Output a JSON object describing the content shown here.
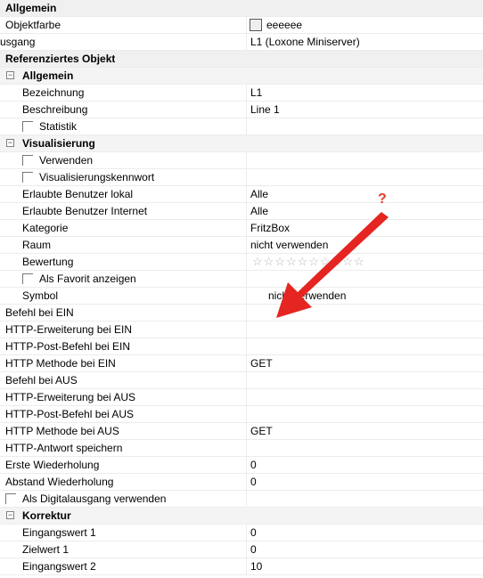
{
  "colors": {
    "accent_arrow": "#e52521",
    "question_mark": "#e23a2e",
    "category_bg": "#f0f0f0"
  },
  "icons": {
    "collapse": "minus-box-icon",
    "checkbox": "checkbox-icon",
    "rating": "star-icon"
  },
  "properties": {
    "cat_allgemein": "Allgemein",
    "objektfarbe": {
      "label": "Objektfarbe",
      "value": "eeeeee",
      "swatch_color": "#eeeeee"
    },
    "ausgang": {
      "label": "usgang",
      "value": "L1 (Loxone Miniserver)"
    },
    "cat_ref": "Referenziertes Objekt",
    "sub_allgemein": "Allgemein",
    "bezeichnung": {
      "label": "Bezeichnung",
      "value": "L1"
    },
    "beschreibung": {
      "label": "Beschreibung",
      "value": "Line 1"
    },
    "statistik": {
      "label": "Statistik",
      "checked": false
    },
    "sub_visualisierung": "Visualisierung",
    "verwenden": {
      "label": "Verwenden",
      "checked": false
    },
    "vis_kennwort": {
      "label": "Visualisierungskennwort",
      "checked": false
    },
    "benutzer_lokal": {
      "label": "Erlaubte Benutzer lokal",
      "value": "Alle"
    },
    "benutzer_internet": {
      "label": "Erlaubte Benutzer Internet",
      "value": "Alle"
    },
    "kategorie": {
      "label": "Kategorie",
      "value": "FritzBox"
    },
    "raum": {
      "label": "Raum",
      "value": "nicht verwenden"
    },
    "bewertung": {
      "label": "Bewertung",
      "stars": "☆☆☆☆☆☆☆☆☆☆",
      "rating": 0,
      "max": 10
    },
    "favorit": {
      "label": "Als Favorit anzeigen",
      "checked": false
    },
    "symbol": {
      "label": "Symbol",
      "value": "nicht verwenden"
    },
    "befehl_ein": {
      "label": "Befehl bei EIN",
      "value": ""
    },
    "http_erw_ein": {
      "label": "HTTP-Erweiterung bei EIN",
      "value": ""
    },
    "http_post_ein": {
      "label": "HTTP-Post-Befehl bei EIN",
      "value": ""
    },
    "http_methode_ein": {
      "label": "HTTP Methode bei EIN",
      "value": "GET"
    },
    "befehl_aus": {
      "label": "Befehl bei AUS",
      "value": ""
    },
    "http_erw_aus": {
      "label": "HTTP-Erweiterung bei AUS",
      "value": ""
    },
    "http_post_aus": {
      "label": "HTTP-Post-Befehl bei AUS",
      "value": ""
    },
    "http_methode_aus": {
      "label": "HTTP Methode bei AUS",
      "value": "GET"
    },
    "http_antwort": {
      "label": "HTTP-Antwort speichern",
      "value": ""
    },
    "erste_wdh": {
      "label": "Erste Wiederholung",
      "value": "0"
    },
    "abstand_wdh": {
      "label": "Abstand Wiederholung",
      "value": "0"
    },
    "digitalausgang": {
      "label": "Als Digitalausgang verwenden",
      "checked": false
    },
    "sub_korrektur": "Korrektur",
    "eingangswert1": {
      "label": "Eingangswert 1",
      "value": "0"
    },
    "zielwert1": {
      "label": "Zielwert 1",
      "value": "0"
    },
    "eingangswert2": {
      "label": "Eingangswert 2",
      "value": "10"
    }
  },
  "annotation": {
    "question_mark": "?"
  }
}
